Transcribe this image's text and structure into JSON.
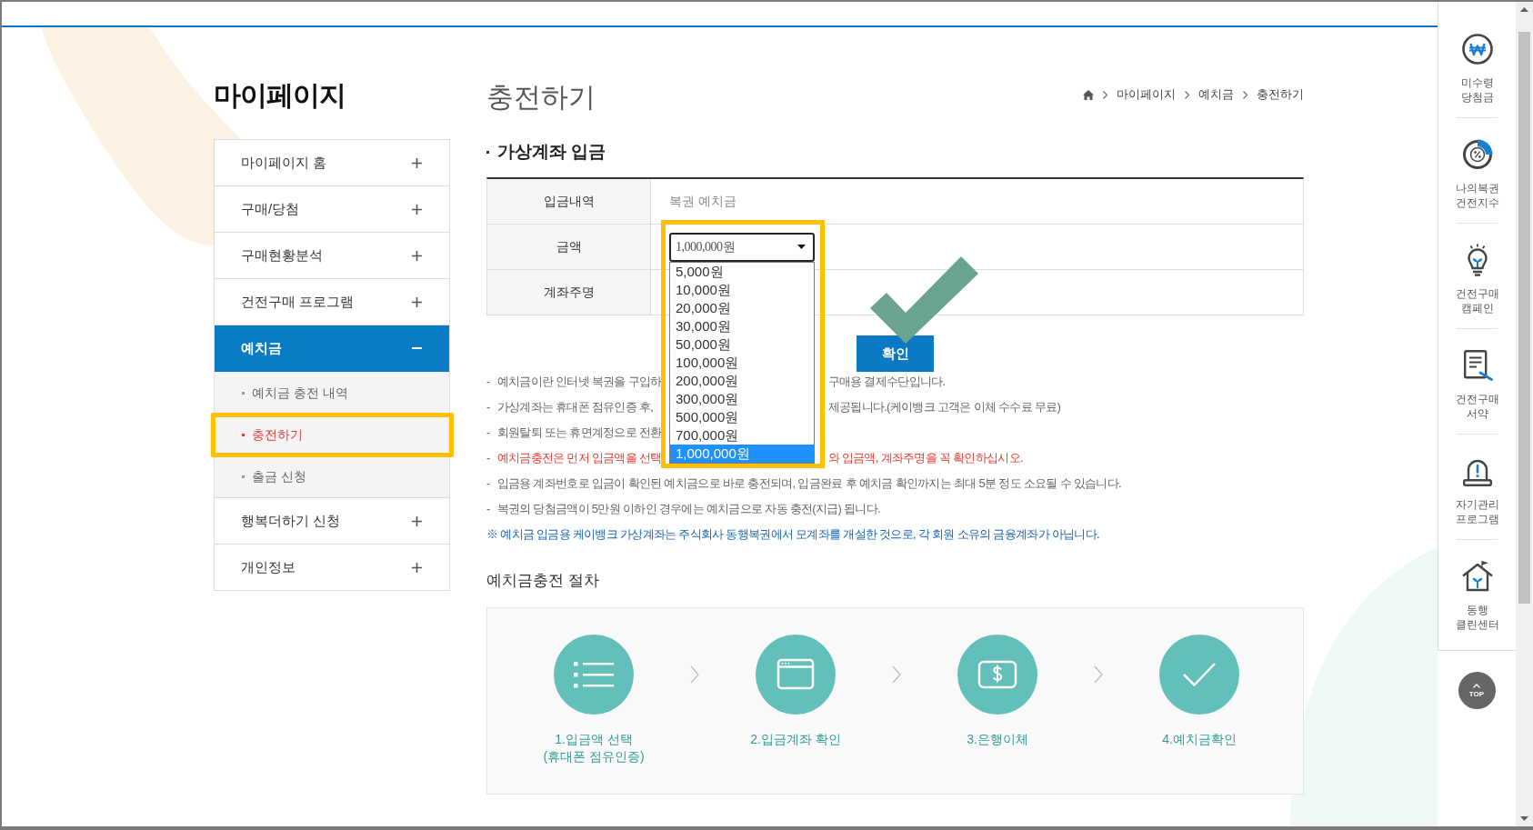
{
  "sidebar": {
    "title": "마이페이지",
    "items": [
      {
        "label": "마이페이지 홈",
        "expanded": false
      },
      {
        "label": "구매/당첨",
        "expanded": false
      },
      {
        "label": "구매현황분석",
        "expanded": false
      },
      {
        "label": "건전구매 프로그램",
        "expanded": false
      },
      {
        "label": "예치금",
        "expanded": true,
        "children": [
          {
            "label": "예치금 충전 내역",
            "selected": false
          },
          {
            "label": "충전하기",
            "selected": true
          },
          {
            "label": "출금 신청",
            "selected": false
          }
        ]
      },
      {
        "label": "행복더하기 신청",
        "expanded": false
      },
      {
        "label": "개인정보",
        "expanded": false
      }
    ]
  },
  "page_title": "충전하기",
  "breadcrumb": [
    "마이페이지",
    "예치금",
    "충전하기"
  ],
  "section_title": "가상계좌 입금",
  "form": {
    "rows": [
      {
        "label": "입금내역",
        "kind": "text",
        "value": "복권 예치금"
      },
      {
        "label": "금액",
        "kind": "select",
        "value": "1,000,000원",
        "open": true,
        "options": [
          {
            "label": "5,000원",
            "selected": false
          },
          {
            "label": "10,000원",
            "selected": false
          },
          {
            "label": "20,000원",
            "selected": false
          },
          {
            "label": "30,000원",
            "selected": false
          },
          {
            "label": "50,000원",
            "selected": false
          },
          {
            "label": "100,000원",
            "selected": false
          },
          {
            "label": "200,000원",
            "selected": false
          },
          {
            "label": "300,000원",
            "selected": false
          },
          {
            "label": "500,000원",
            "selected": false
          },
          {
            "label": "700,000원",
            "selected": false
          },
          {
            "label": "1,000,000원",
            "selected": true
          }
        ]
      },
      {
        "label": "계좌주명",
        "kind": "text"
      }
    ]
  },
  "confirm_button": "확인",
  "notes": [
    {
      "kind": "plain",
      "bullet": "-",
      "parts": [
        "예치금이란 인터넷 복권을 구입하",
        "구매용 결제수단입니다."
      ]
    },
    {
      "kind": "plain",
      "bullet": "-",
      "parts": [
        "가상계좌는 휴대폰 점유인증 후,",
        "제공됩니다.(케이뱅크 고객은 이체 수수료 무료)"
      ]
    },
    {
      "kind": "plain",
      "bullet": "-",
      "parts": [
        "회원탈퇴 또는 휴면계정으로 전환"
      ]
    },
    {
      "kind": "warning",
      "bullet": "-",
      "parts": [
        "예치금충전은 먼저 입금액을 선택",
        "와 입금액, 계좌주명을 꼭 확인하십시오."
      ]
    },
    {
      "kind": "plain",
      "bullet": "-",
      "parts": [
        "입금용 계좌번호로 입금이 확인된 예치금으로 바로 충전되며, 입금완료 후 예치금 확인까지는 최대 5분 정도 소요될 수 있습니다."
      ]
    },
    {
      "kind": "plain",
      "bullet": "-",
      "parts": [
        "복권의 당첨금액이 5만원 이하인 경우에는 예치금으로 자동 충전(지급) 됩니다."
      ]
    },
    {
      "kind": "notice",
      "parts": [
        "※ 예치금 입금용 케이뱅크 가상계좌는 주식회사 동행복권에서 모계좌를 개설한 것으로, 각 회원 소유의 금융계좌가 아닙니다."
      ]
    }
  ],
  "procedure": {
    "title": "예치금충전 절차",
    "steps": [
      {
        "kind": "list",
        "label": "1.입금액 선택\n(휴대폰 점유인증)"
      },
      {
        "kind": "window",
        "label": "2.입금계좌 확인"
      },
      {
        "kind": "bill",
        "label": "3.은행이체"
      },
      {
        "kind": "check",
        "label": "4.예치금확인"
      }
    ]
  },
  "quick_menu": {
    "items": [
      {
        "kind": "won",
        "label": "미수령\n당첨금"
      },
      {
        "kind": "chart",
        "label": "나의복권\n건전지수"
      },
      {
        "kind": "bulb",
        "label": "건전구매\n캠페인"
      },
      {
        "kind": "pledge",
        "label": "건전구매\n서약"
      },
      {
        "kind": "alarm",
        "label": "자기관리\n프로그램"
      },
      {
        "kind": "house",
        "label": "동행\n클린센터"
      }
    ],
    "top_button": "TOP"
  }
}
